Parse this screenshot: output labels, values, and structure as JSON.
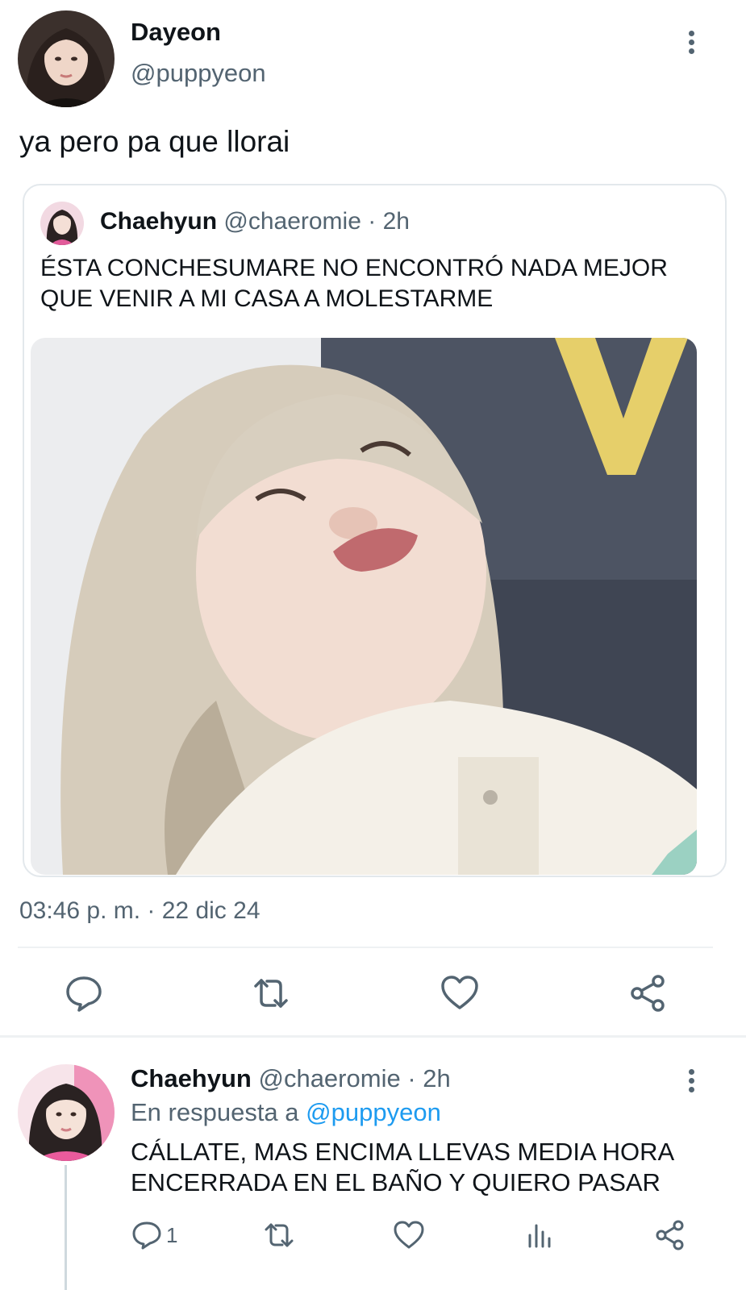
{
  "main_tweet": {
    "display_name": "Dayeon",
    "handle": "@puppyeon",
    "text": "ya pero pa que llorai",
    "timestamp": "03:46 p. m. · 22 dic 24",
    "actions": [
      "reply-icon",
      "retweet-icon",
      "like-icon",
      "share-icon"
    ]
  },
  "quoted_tweet": {
    "display_name": "Chaehyun",
    "handle": "@chaeromie",
    "time": "· 2h",
    "text": "ÉSTA CONCHESUMARE NO ENCONTRÓ NADA MEJOR QUE VENIR A MI CASA A MOLESTARME"
  },
  "reply_tweet": {
    "display_name": "Chaehyun",
    "handle": "@chaeromie",
    "time": "· 2h",
    "reply_prefix": "En respuesta a",
    "reply_target": "@puppyeon",
    "text": "CÁLLATE, MAS ENCIMA LLEVAS MEDIA HORA ENCERRADA EN EL BAÑO Y QUIERO PASAR",
    "reply_count": "1",
    "actions": [
      "reply-icon",
      "retweet-icon",
      "like-icon",
      "views-icon",
      "share-icon"
    ]
  },
  "colors": {
    "text": "#0f1419",
    "muted": "#536471",
    "link": "#1d9bf0",
    "border": "#e3e8ec"
  }
}
